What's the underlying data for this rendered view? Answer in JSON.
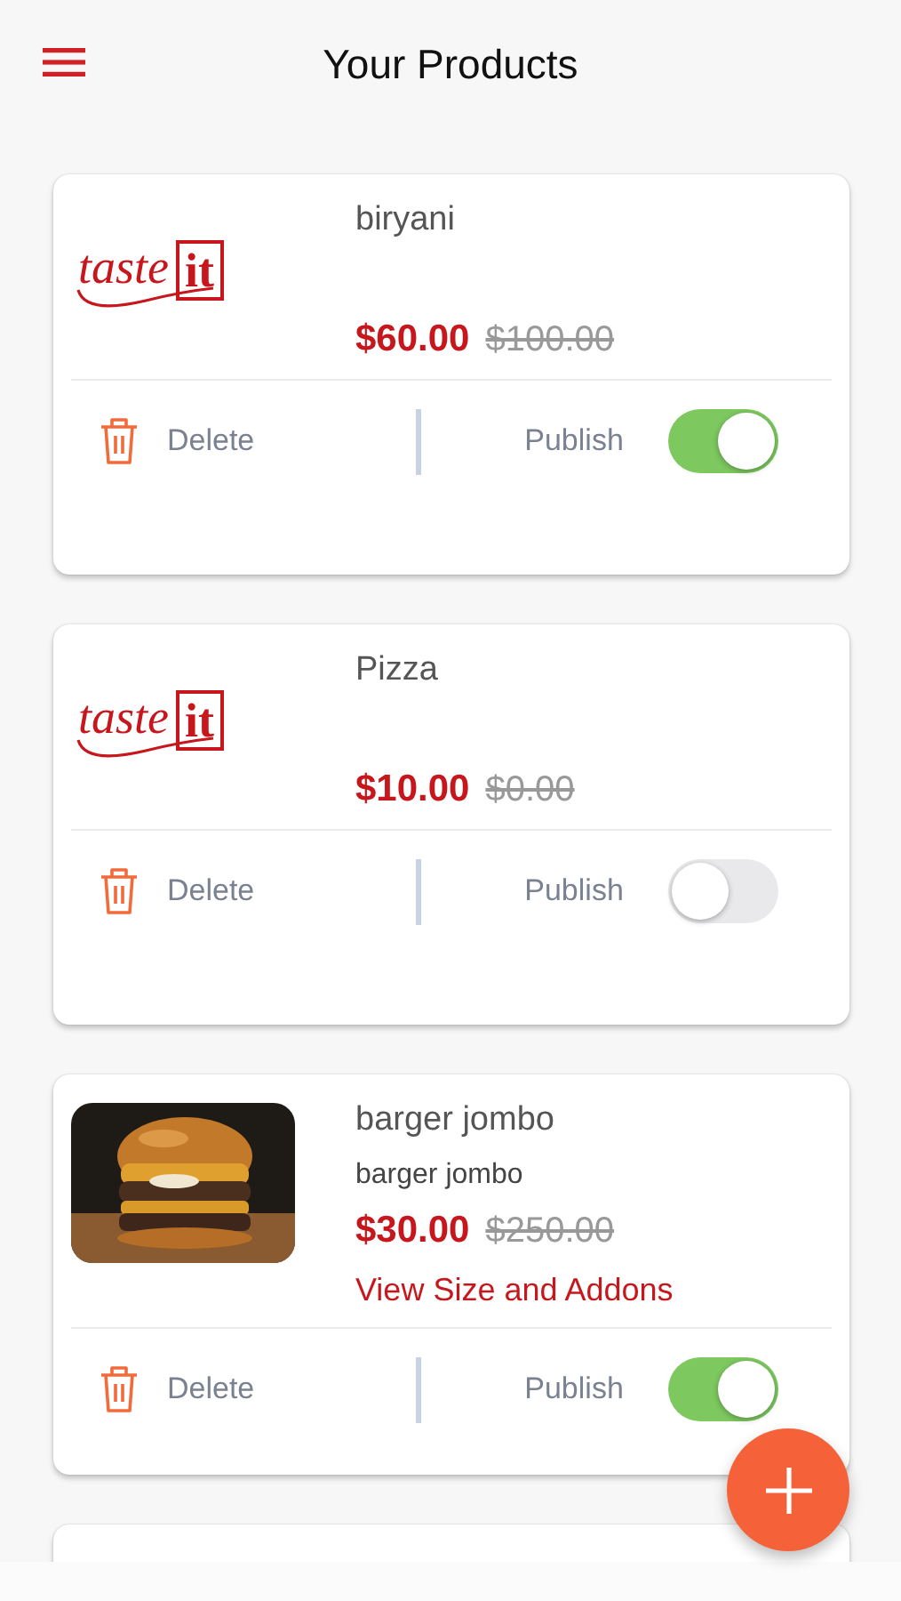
{
  "header": {
    "title": "Your Products"
  },
  "products": [
    {
      "image": {
        "kind": "logo",
        "word": "taste",
        "mark": "it"
      },
      "name": "biryani",
      "price": "$60.00",
      "old_price": "$100.00",
      "delete_label": "Delete",
      "publish_label": "Publish",
      "published": true
    },
    {
      "image": {
        "kind": "logo",
        "word": "taste",
        "mark": "it"
      },
      "name": "Pizza",
      "price": "$10.00",
      "old_price": "$0.00",
      "delete_label": "Delete",
      "publish_label": "Publish",
      "published": false
    },
    {
      "name": "barger jombo",
      "subtitle": "barger jombo",
      "price": "$30.00",
      "old_price": "$250.00",
      "link": "View Size and Addons",
      "delete_label": "Delete",
      "publish_label": "Publish",
      "published": true
    }
  ]
}
